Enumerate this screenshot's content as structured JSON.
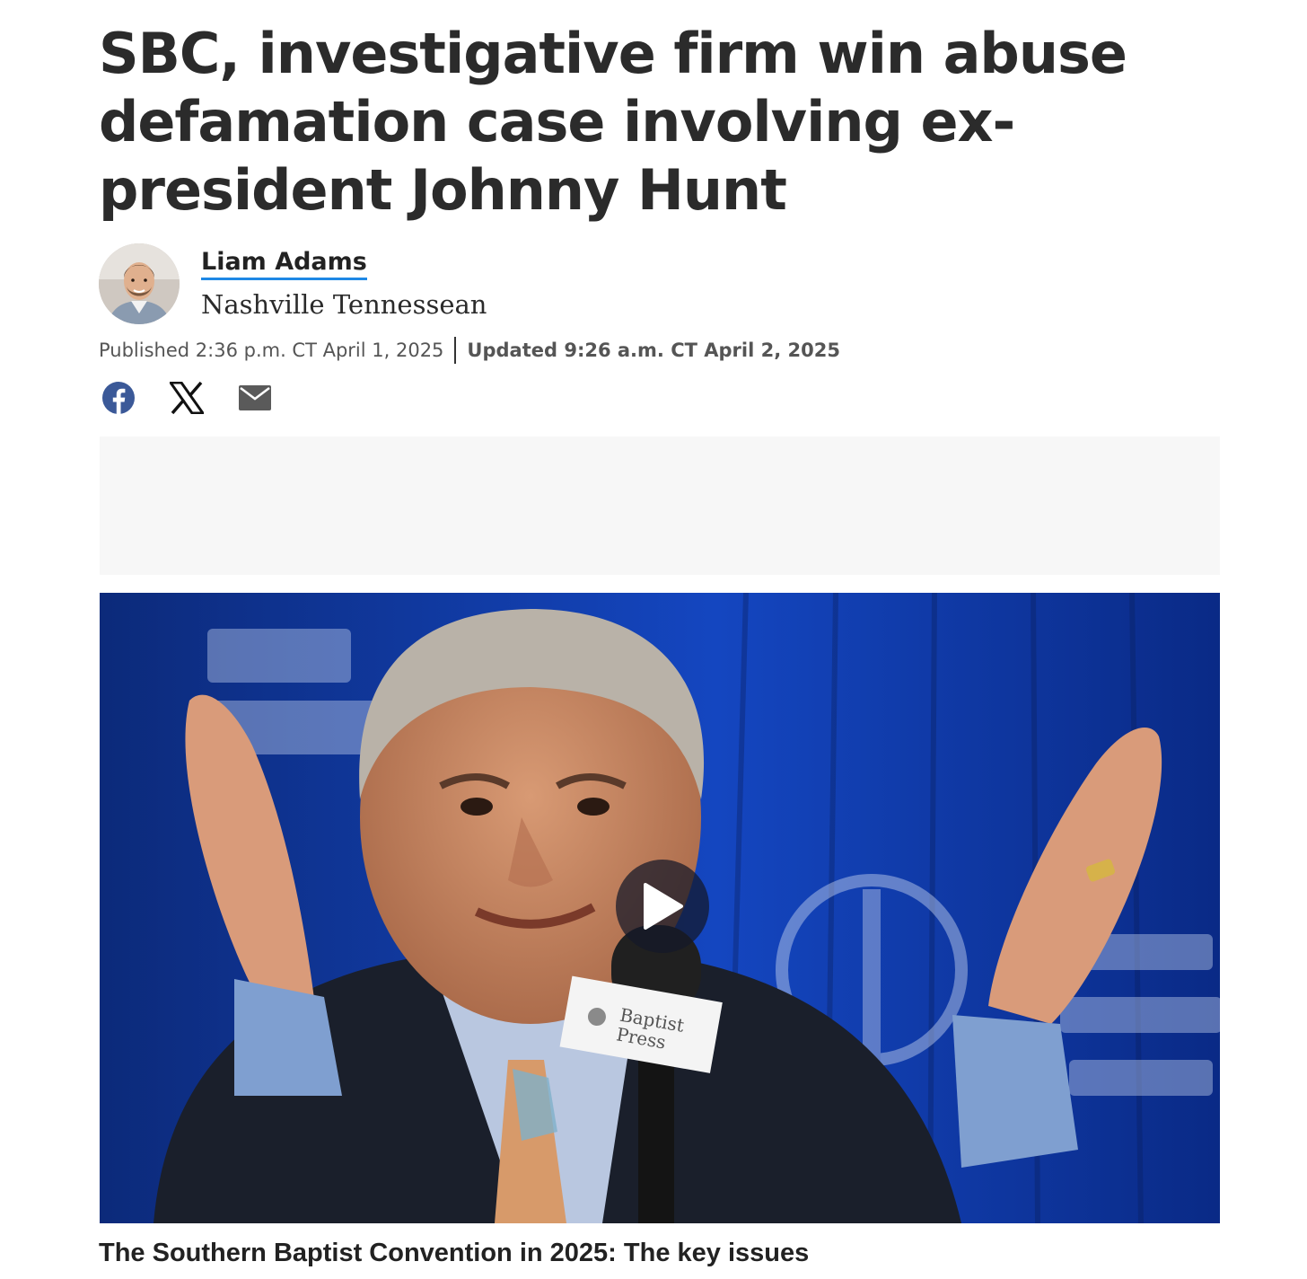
{
  "article": {
    "headline": "SBC, investigative firm win abuse defamation case involving ex-president Johnny Hunt",
    "author": {
      "name": "Liam Adams",
      "publication": "Nashville Tennessean"
    },
    "published": "Published 2:36 p.m. CT April 1, 2025",
    "updated": "Updated 9:26 a.m. CT April 2, 2025"
  },
  "share": {
    "items": [
      "facebook-icon",
      "x-icon",
      "email-icon"
    ]
  },
  "media": {
    "caption": "The Southern Baptist Convention in 2025: The key issues",
    "mic_label_line1": "Baptist",
    "mic_label_line2": "Press",
    "icon": "play-icon"
  },
  "colors": {
    "author_underline": "#1e88e5",
    "facebook": "#3b5998",
    "ad_background": "#f7f7f7",
    "backdrop_blue": "#0b2f8a"
  }
}
